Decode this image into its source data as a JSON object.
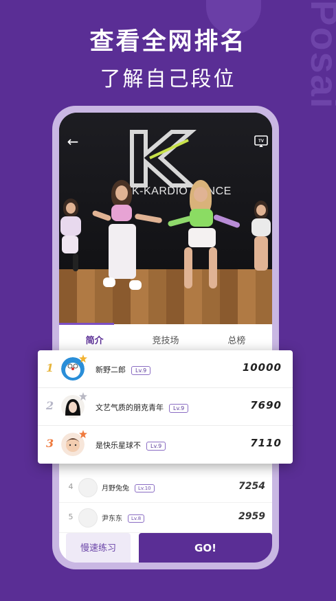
{
  "promo": {
    "headline": "查看全网排名",
    "subline": "了解自己段位",
    "watermark": "Posai"
  },
  "video": {
    "logo_text": "K-KARDIO DANCE",
    "back_icon": "arrow-left-icon",
    "cast_icon": "tv-cast-icon"
  },
  "tabs": [
    {
      "label": "简介",
      "active": true
    },
    {
      "label": "竞技场",
      "active": false
    },
    {
      "label": "总榜",
      "active": false
    }
  ],
  "top3": [
    {
      "rank": "1",
      "name": "新野二郎",
      "level": "Lv.9",
      "score": "10000",
      "rank_color": "#e7b53c",
      "star_color": "#f2b230"
    },
    {
      "rank": "2",
      "name": "文艺气质的朋克青年",
      "level": "Lv.9",
      "score": "7690",
      "rank_color": "#b7b7c8",
      "star_color": "#b9b9c4"
    },
    {
      "rank": "3",
      "name": "是快乐星球不",
      "level": "Lv.9",
      "score": "7110",
      "rank_color": "#ef7a3e",
      "star_color": "#ef7a3e"
    }
  ],
  "leaderboard": [
    {
      "rank": "4",
      "name": "月野兔兔",
      "level": "Lv.10",
      "score": "7254"
    },
    {
      "rank": "5",
      "name": "尹东东",
      "level": "Lv.8",
      "score": "2959"
    }
  ],
  "buttons": {
    "slow_practice": "慢速练习",
    "go": "GO!"
  },
  "colors": {
    "brand_purple": "#5a2e95",
    "phone_frame": "#c9b7e3"
  }
}
